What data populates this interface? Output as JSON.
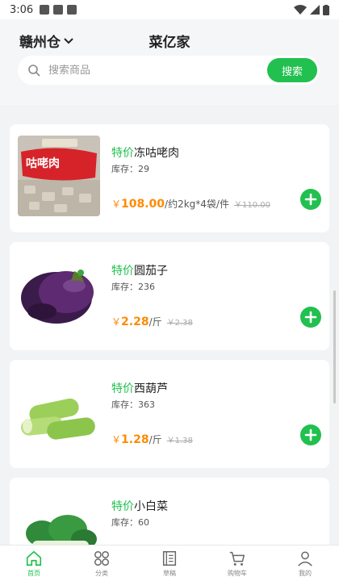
{
  "status_bar": {
    "time": "3:06"
  },
  "header": {
    "warehouse": "赣州仓",
    "title": "菜亿家"
  },
  "search": {
    "placeholder": "搜索商品",
    "button_label": "搜索"
  },
  "products": [
    {
      "tag": "特价",
      "name": "冻咕咾肉",
      "stock": "库存：29",
      "price": "108.00",
      "unit": "/约2kg*4袋/件",
      "original": "￥110.00",
      "image_text": "咕咾肉"
    },
    {
      "tag": "特价",
      "name": "圆茄子",
      "stock": "库存：236",
      "price": "2.28",
      "unit": "/斤",
      "original": "￥2.38"
    },
    {
      "tag": "特价",
      "name": "西葫芦",
      "stock": "库存：363",
      "price": "1.28",
      "unit": "/斤",
      "original": "￥1.38"
    },
    {
      "tag": "特价",
      "name": "小白菜",
      "stock": "库存：60"
    }
  ],
  "currency_symbol": "￥",
  "tabs": [
    {
      "label": "首页",
      "icon": "home-icon",
      "active": true
    },
    {
      "label": "分类",
      "icon": "category-icon",
      "active": false
    },
    {
      "label": "草稿",
      "icon": "draft-icon",
      "active": false
    },
    {
      "label": "购物车",
      "icon": "cart-icon",
      "active": false
    },
    {
      "label": "我的",
      "icon": "profile-icon",
      "active": false
    }
  ],
  "colors": {
    "accent": "#21c04f",
    "price": "#ff8a00"
  }
}
